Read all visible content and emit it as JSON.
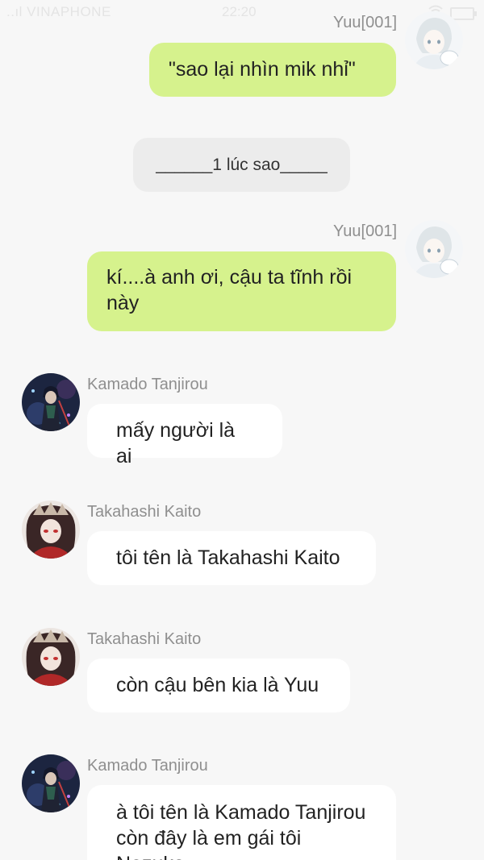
{
  "status_bar": {
    "carrier": "..ıl VINAPHONE",
    "time": "22:20",
    "wifi_icon": "wifi-icon",
    "battery_icon": "battery-icon"
  },
  "messages": [
    {
      "type": "outgoing",
      "sender": "Yuu[001]",
      "text": "\"sao lại nhìn mik nhỉ\"",
      "avatar": "yuu-avatar"
    },
    {
      "type": "system",
      "text": "______1 lúc sao_____"
    },
    {
      "type": "outgoing",
      "sender": "Yuu[001]",
      "text": "kí....à anh ơi, cậu ta tĩnh rồi này",
      "avatar": "yuu-avatar"
    },
    {
      "type": "incoming",
      "sender": "Kamado Tanjirou",
      "text": "mấy người là ai",
      "avatar": "tanjirou-avatar"
    },
    {
      "type": "incoming",
      "sender": "Takahashi Kaito",
      "text": "tôi tên là Takahashi Kaito",
      "avatar": "kaito-avatar"
    },
    {
      "type": "incoming",
      "sender": "Takahashi Kaito",
      "text": "còn cậu bên kia là Yuu",
      "avatar": "kaito-avatar"
    },
    {
      "type": "incoming",
      "sender": "Kamado Tanjirou",
      "text": "à tôi tên là Kamado Tanjirou còn đây là em gái tôi Nezuko",
      "avatar": "tanjirou-avatar"
    }
  ],
  "colors": {
    "background": "#f7f7f7",
    "outgoing_bubble": "#d6f28d",
    "incoming_bubble": "#ffffff",
    "system_bubble": "#ececec",
    "sender_name": "#8f8f8f"
  }
}
